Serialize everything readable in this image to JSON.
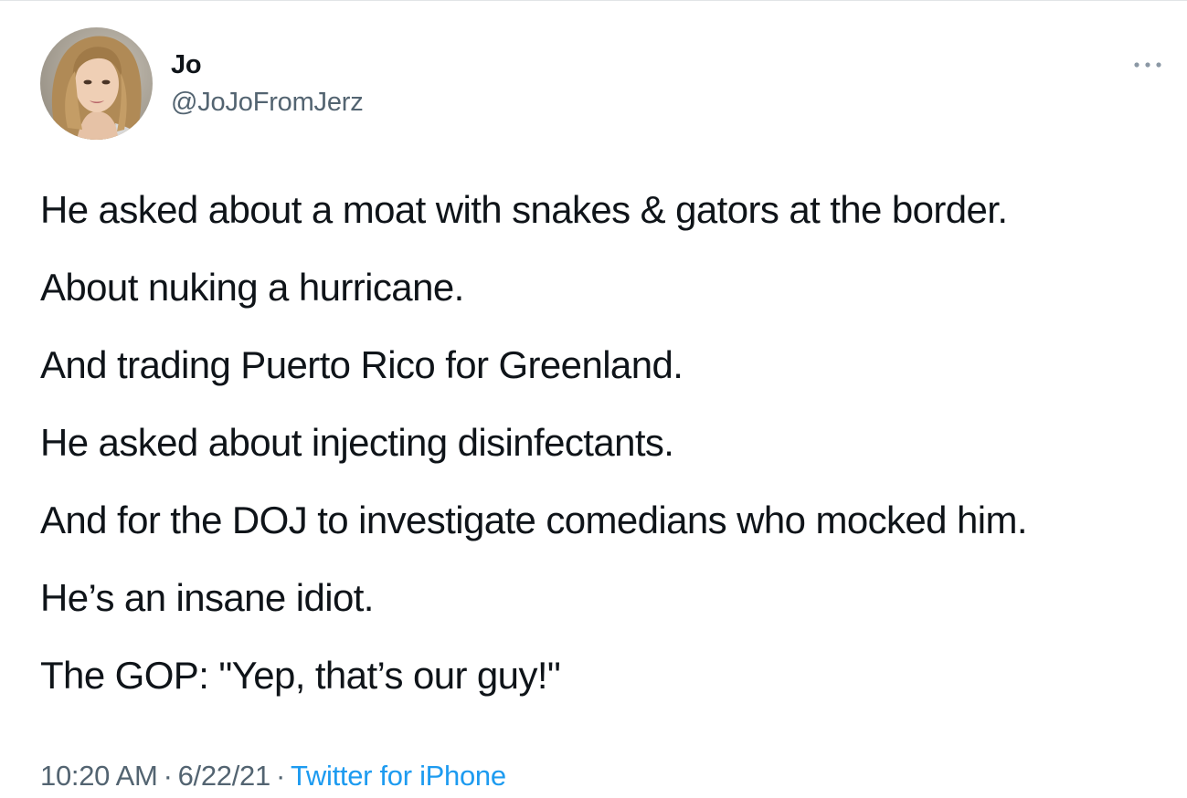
{
  "author": {
    "display_name": "Jo",
    "handle": "@JoJoFromJerz",
    "avatar_icon": "profile-photo"
  },
  "more_menu_icon": "more-horizontal-icon",
  "tweet": {
    "lines": [
      "He asked about a moat with snakes & gators at the border.",
      "About nuking a hurricane.",
      "And trading Puerto Rico for Greenland.",
      "He asked about injecting disinfectants.",
      "And for the DOJ to investigate comedians who mocked him.",
      "He’s an insane idiot.",
      "The GOP: \"Yep, that’s our guy!\""
    ]
  },
  "meta": {
    "time": "10:20 AM",
    "separator": "·",
    "date": "6/22/21",
    "source": "Twitter for iPhone"
  },
  "colors": {
    "text": "#0f1419",
    "secondary": "#536471",
    "link": "#1d9bf0"
  }
}
